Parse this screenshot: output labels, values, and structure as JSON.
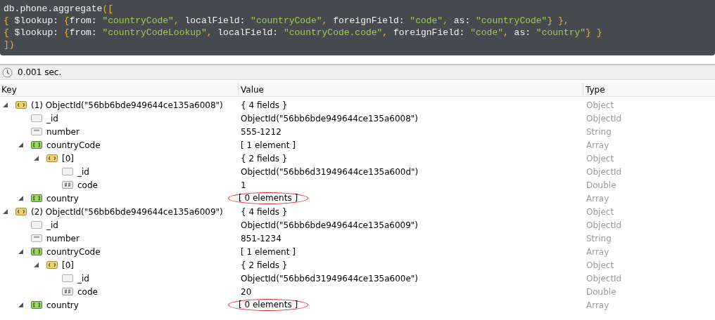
{
  "query": {
    "lines": [
      [
        {
          "kind": "plain",
          "text": "db.phone.aggregate"
        },
        {
          "kind": "punct",
          "text": "(["
        }
      ],
      [
        {
          "kind": "punct",
          "text": "{ "
        },
        {
          "kind": "plain",
          "text": "$lookup: "
        },
        {
          "kind": "punct",
          "text": "{"
        },
        {
          "kind": "plain",
          "text": "from: "
        },
        {
          "kind": "string",
          "text": "\"countryCode\""
        },
        {
          "kind": "punct",
          "text": ", "
        },
        {
          "kind": "plain",
          "text": "localField: "
        },
        {
          "kind": "string",
          "text": "\"countryCode\""
        },
        {
          "kind": "punct",
          "text": ", "
        },
        {
          "kind": "plain",
          "text": "foreignField: "
        },
        {
          "kind": "string",
          "text": "\"code\""
        },
        {
          "kind": "punct",
          "text": ", "
        },
        {
          "kind": "plain",
          "text": "as: "
        },
        {
          "kind": "string",
          "text": "\"countryCode\""
        },
        {
          "kind": "punct",
          "text": "} },"
        }
      ],
      [
        {
          "kind": "punct",
          "text": "{ "
        },
        {
          "kind": "plain",
          "text": "$lookup: "
        },
        {
          "kind": "punct",
          "text": "{"
        },
        {
          "kind": "plain",
          "text": "from: "
        },
        {
          "kind": "string",
          "text": "\"countryCodeLookup\""
        },
        {
          "kind": "punct",
          "text": ", "
        },
        {
          "kind": "plain",
          "text": "localField: "
        },
        {
          "kind": "string",
          "text": "\"countryCode.code\""
        },
        {
          "kind": "punct",
          "text": ", "
        },
        {
          "kind": "plain",
          "text": "foreignField: "
        },
        {
          "kind": "string",
          "text": "\"code\""
        },
        {
          "kind": "punct",
          "text": ", "
        },
        {
          "kind": "plain",
          "text": "as: "
        },
        {
          "kind": "string",
          "text": "\"country\""
        },
        {
          "kind": "punct",
          "text": "} }"
        }
      ],
      [
        {
          "kind": "punct",
          "text": "])"
        }
      ]
    ]
  },
  "status": {
    "time": "0.001 sec."
  },
  "table": {
    "columns": [
      "Key",
      "Value",
      "Type"
    ],
    "rows": [
      {
        "kind": "object",
        "key": "(1) ObjectId(\"56bb6bde949644ce135a6008\")",
        "value": "{ 4 fields }",
        "type": "Object",
        "expanded": true,
        "circled": false,
        "children": [
          {
            "kind": "oid",
            "key": "_id",
            "value": "ObjectId(\"56bb6bde949644ce135a6008\")",
            "type": "ObjectId",
            "circled": false
          },
          {
            "kind": "string",
            "key": "number",
            "value": "555-1212",
            "type": "String",
            "circled": false
          },
          {
            "kind": "array",
            "key": "countryCode",
            "value": "[ 1 element ]",
            "type": "Array",
            "expanded": true,
            "circled": false,
            "children": [
              {
                "kind": "object",
                "key": "[0]",
                "value": "{ 2 fields }",
                "type": "Object",
                "expanded": true,
                "circled": false,
                "children": [
                  {
                    "kind": "oid",
                    "key": "_id",
                    "value": "ObjectId(\"56bb6d31949644ce135a600d\")",
                    "type": "ObjectId",
                    "circled": false
                  },
                  {
                    "kind": "double",
                    "key": "code",
                    "value": "1",
                    "type": "Double",
                    "circled": false
                  }
                ]
              }
            ]
          },
          {
            "kind": "array",
            "key": "country",
            "value": "[ 0 elements ]",
            "type": "Array",
            "expanded": true,
            "circled": true
          }
        ]
      },
      {
        "kind": "object",
        "key": "(2) ObjectId(\"56bb6bde949644ce135a6009\")",
        "value": "{ 4 fields }",
        "type": "Object",
        "expanded": true,
        "circled": false,
        "children": [
          {
            "kind": "oid",
            "key": "_id",
            "value": "ObjectId(\"56bb6bde949644ce135a6009\")",
            "type": "ObjectId",
            "circled": false
          },
          {
            "kind": "string",
            "key": "number",
            "value": "851-1234",
            "type": "String",
            "circled": false
          },
          {
            "kind": "array",
            "key": "countryCode",
            "value": "[ 1 element ]",
            "type": "Array",
            "expanded": true,
            "circled": false,
            "children": [
              {
                "kind": "object",
                "key": "[0]",
                "value": "{ 2 fields }",
                "type": "Object",
                "expanded": true,
                "circled": false,
                "children": [
                  {
                    "kind": "oid",
                    "key": "_id",
                    "value": "ObjectId(\"56bb6d31949644ce135a600e\")",
                    "type": "ObjectId",
                    "circled": false
                  },
                  {
                    "kind": "double",
                    "key": "code",
                    "value": "20",
                    "type": "Double",
                    "circled": false
                  }
                ]
              }
            ]
          },
          {
            "kind": "array",
            "key": "country",
            "value": "[ 0 elements ]",
            "type": "Array",
            "expanded": true,
            "circled": true
          }
        ]
      }
    ]
  }
}
